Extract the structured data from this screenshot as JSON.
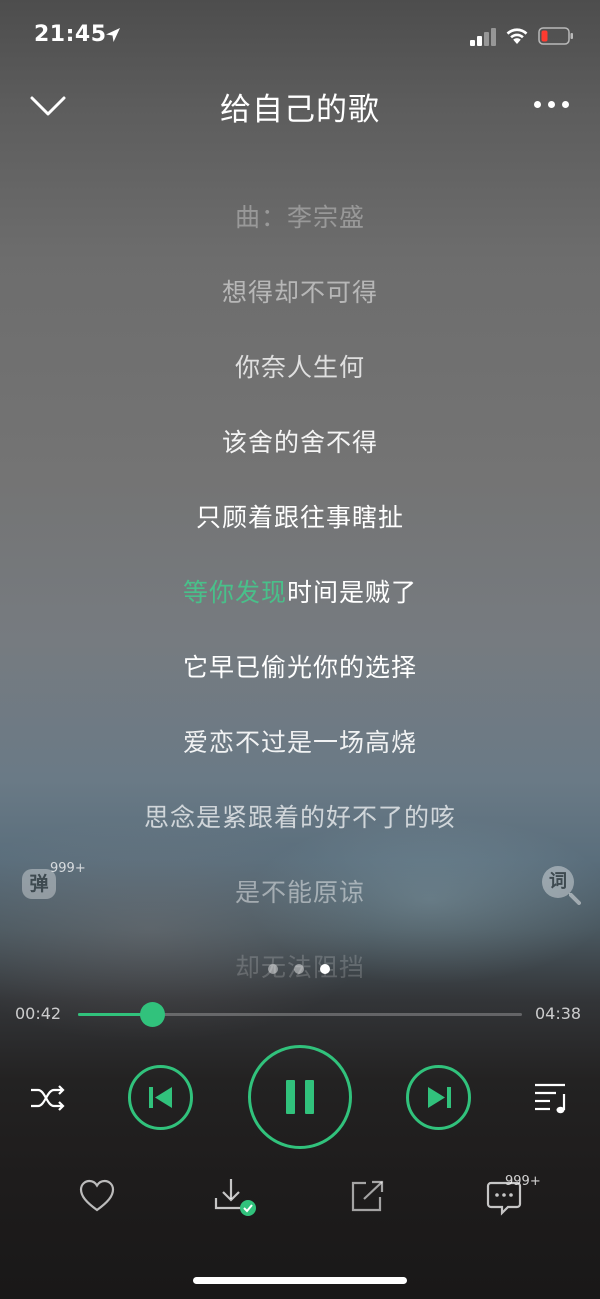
{
  "status_bar": {
    "time": "21:45",
    "icons": [
      "location-arrow-icon",
      "cellular-signal-icon",
      "wifi-icon",
      "battery-low-icon"
    ]
  },
  "header": {
    "title": "给自己的歌",
    "back_icon": "chevron-down-icon",
    "more_icon": "more-dots-icon"
  },
  "lyrics": {
    "lines": [
      "曲：李宗盛",
      "想得却不可得",
      "你奈人生何",
      "该舍的舍不得",
      "只顾着跟往事瞎扯",
      "等你发现时间是贼了",
      "它早已偷光你的选择",
      "爱恋不过是一场高烧",
      "思念是紧跟着的好不了的咳",
      "是不能原谅",
      "却无法阻挡"
    ],
    "current_line_sung": "等你发现",
    "current_line_rest": "时间是贼了",
    "accent_color": "#49c08a"
  },
  "side_buttons": {
    "danmu_label": "弹",
    "danmu_count": "999+",
    "lyric_search_label": "词"
  },
  "pager": {
    "page_count": 3,
    "active_page": 3
  },
  "progress": {
    "current_time": "00:42",
    "total_time": "04:38",
    "fraction": 0.167,
    "accent_color": "#31c27c"
  },
  "controls": {
    "shuffle_icon": "shuffle-icon",
    "prev_icon": "skip-previous-icon",
    "pause_icon": "pause-icon",
    "next_icon": "skip-next-icon",
    "playlist_icon": "playlist-icon"
  },
  "actions": {
    "like_icon": "heart-icon",
    "download_icon": "download-done-icon",
    "share_icon": "share-icon",
    "comment_icon": "comment-icon",
    "comment_count": "999+"
  }
}
